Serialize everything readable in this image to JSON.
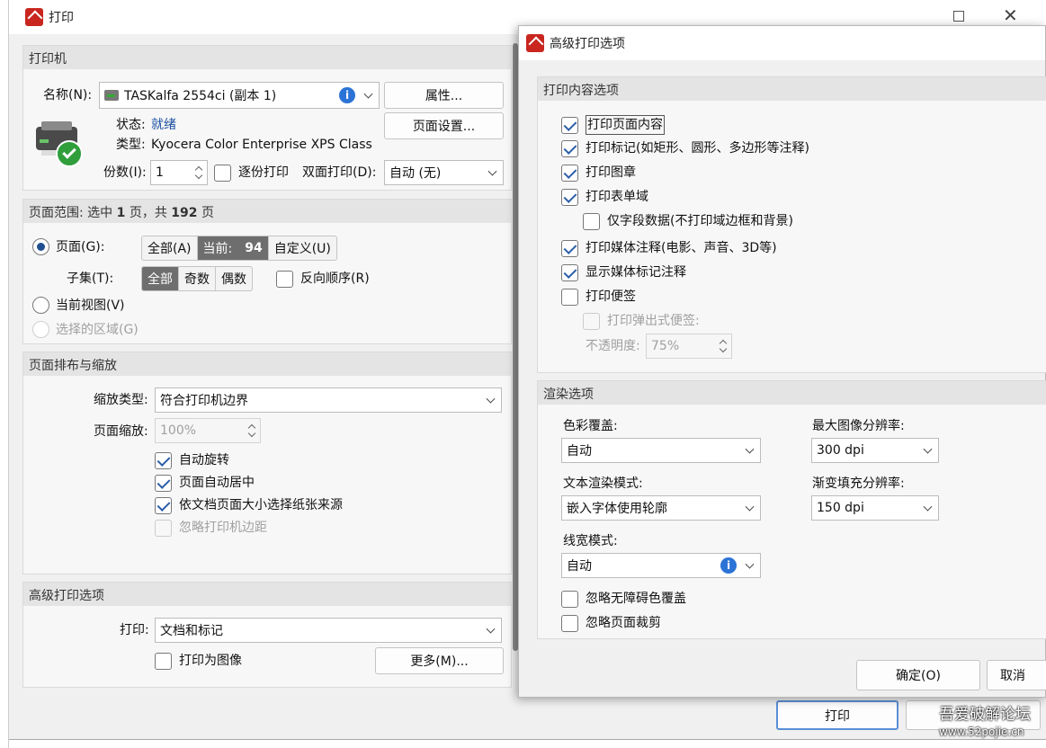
{
  "print_window": {
    "title": "打印",
    "printer": {
      "header": "打印机",
      "name_label": "名称(N):",
      "name_value": "TASKalfa 2554ci (副本 1)",
      "properties": "属性...",
      "page_setup": "页面设置...",
      "status_label": "状态:",
      "status_value": "就绪",
      "type_label": "类型:",
      "type_value": "Kyocera Color Enterprise XPS Class",
      "copies_label": "份数(I):",
      "copies_value": "1",
      "collate": "逐份打印",
      "duplex_label": "双面打印(D):",
      "duplex_value": "自动 (无)"
    },
    "range": {
      "header_pre": "页面范围: 选中 ",
      "selected": "1",
      "header_mid": " 页，共 ",
      "total": "192",
      "header_post": " 页",
      "pages_radio": "页面(G):",
      "all": "全部(A)",
      "current_label": "当前:",
      "current_value": "94",
      "custom": "自定义(U)",
      "subset_label": "子集(T):",
      "subset_all": "全部",
      "subset_odd": "奇数",
      "subset_even": "偶数",
      "reverse": "反向顺序(R)",
      "current_view": "当前视图(V)",
      "selection": "选择的区域(G)"
    },
    "layout": {
      "header": "页面排布与缩放",
      "scale_type_label": "缩放类型:",
      "scale_type_value": "符合打印机边界",
      "page_zoom_label": "页面缩放:",
      "page_zoom_value": "100%",
      "auto_rotate": "自动旋转",
      "auto_center": "页面自动居中",
      "choose_paper": "依文档页面大小选择纸张来源",
      "ignore_margins": "忽略打印机边距"
    },
    "advanced": {
      "header": "高级打印选项",
      "print_label": "打印:",
      "print_value": "文档和标记",
      "print_as_image": "打印为图像",
      "more": "更多(M)..."
    },
    "print_button": "打印"
  },
  "adv_window": {
    "title": "高级打印选项",
    "content": {
      "header": "打印内容选项",
      "print_page_content": "打印页面内容",
      "print_markups": "打印标记(如矩形、圆形、多边形等注释)",
      "print_stamps": "打印图章",
      "print_form_fields": "打印表单域",
      "field_data_only": "仅字段数据(不打印域边框和背景)",
      "print_media": "打印媒体注释(电影、声音、3D等)",
      "show_media_markup": "显示媒体标记注释",
      "print_notes": "打印便签",
      "print_popup_notes": "打印弹出式便签:",
      "opacity_label": "不透明度:",
      "opacity_value": "75%"
    },
    "render": {
      "header": "渲染选项",
      "color_override_label": "色彩覆盖:",
      "color_override_value": "自动",
      "max_res_label": "最大图像分辨率:",
      "max_res_value": "300 dpi",
      "text_mode_label": "文本渲染模式:",
      "text_mode_value": "嵌入字体使用轮廓",
      "gradient_label": "渐变填充分辨率:",
      "gradient_value": "150 dpi",
      "line_width_label": "线宽模式:",
      "line_width_value": "自动",
      "ignore_accessible_colors": "忽略无障碍色覆盖",
      "ignore_crop": "忽略页面裁剪"
    },
    "ok": "确定(O)",
    "cancel": "取消"
  },
  "watermark": {
    "line1": "吾爱破解论坛",
    "line2": "www.52pojie.cn"
  },
  "colors": {
    "accent": "#2b73d6",
    "header_bg": "#e4e4e4",
    "app_icon": "#c8261f"
  }
}
